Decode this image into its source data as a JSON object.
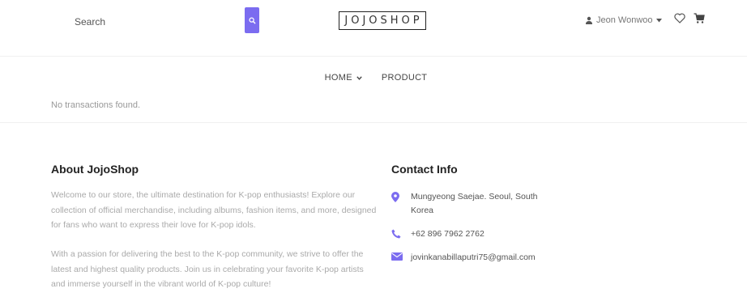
{
  "header": {
    "search_placeholder": "Search",
    "brand": "JOJOSHOP",
    "user_name": "Jeon Wonwoo",
    "icons": {
      "search": "search-icon",
      "user": "user-icon",
      "caret": "caret-down-icon",
      "wishlist": "heart-icon",
      "cart": "cart-icon"
    },
    "accent_color": "#7b6cf0"
  },
  "nav": {
    "items": [
      {
        "label": "HOME",
        "has_dropdown": true
      },
      {
        "label": "PRODUCT",
        "has_dropdown": false
      }
    ]
  },
  "main": {
    "empty_message": "No transactions found."
  },
  "footer": {
    "about": {
      "title": "About JojoShop",
      "paragraphs": [
        "Welcome to our store, the ultimate destination for K-pop enthusiasts! Explore our collection of official merchandise, including albums, fashion items, and more, designed for fans who want to express their love for K-pop idols.",
        "With a passion for delivering the best to the K-pop community, we strive to offer the latest and highest quality products. Join us in celebrating your favorite K-pop artists and immerse yourself in the vibrant world of K-pop culture!"
      ]
    },
    "contact": {
      "title": "Contact Info",
      "address": "Mungyeong Saejae. Seoul, South Korea",
      "phone": "+62 896 7962 2762",
      "email": "jovinkanabillaputri75@gmail.com",
      "icons": {
        "address": "map-pin-icon",
        "phone": "phone-icon",
        "email": "envelope-icon"
      },
      "icon_color": "#7b6cf0"
    }
  }
}
